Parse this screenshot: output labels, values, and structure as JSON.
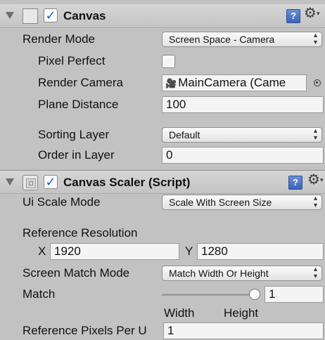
{
  "canvas": {
    "title": "Canvas",
    "enabled": true,
    "render_mode": {
      "label": "Render Mode",
      "value": "Screen Space - Camera"
    },
    "pixel_perfect": {
      "label": "Pixel Perfect",
      "checked": false
    },
    "render_camera": {
      "label": "Render Camera",
      "value": "MainCamera (Came"
    },
    "plane_distance": {
      "label": "Plane Distance",
      "value": "100"
    },
    "sorting_layer": {
      "label": "Sorting Layer",
      "value": "Default"
    },
    "order_in_layer": {
      "label": "Order in Layer",
      "value": "0"
    }
  },
  "canvas_scaler": {
    "title": "Canvas Scaler (Script)",
    "enabled": true,
    "ui_scale_mode": {
      "label": "Ui Scale Mode",
      "value": "Scale With Screen Size"
    },
    "reference_resolution": {
      "label": "Reference Resolution",
      "x_label": "X",
      "x_value": "1920",
      "y_label": "Y",
      "y_value": "1280"
    },
    "screen_match_mode": {
      "label": "Screen Match Mode",
      "value": "Match Width Or Height"
    },
    "match": {
      "label": "Match",
      "value": "1",
      "level": 1.0,
      "min_label": "Width",
      "max_label": "Height"
    },
    "reference_pixels": {
      "label": "Reference Pixels Per U",
      "value": "1"
    }
  },
  "icons": {
    "help": "help-icon",
    "gear": "gear-icon",
    "fold": "foldout-arrow-icon",
    "camera": "camera-icon",
    "target": "object-picker-icon",
    "dropdown": "dropdown-arrows-icon"
  }
}
